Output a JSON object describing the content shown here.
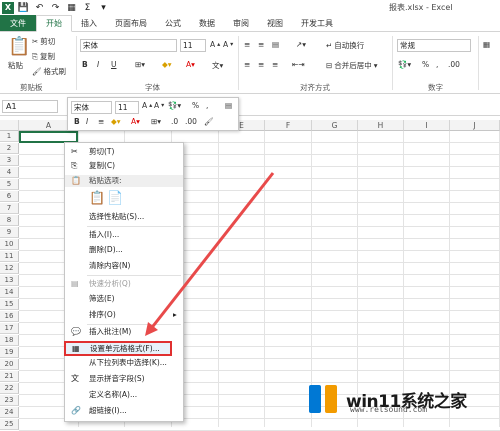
{
  "title_bar": {
    "doc_title": "报表.xlsx - Excel",
    "sum_glyph": "Σ"
  },
  "tabs": [
    {
      "label": "文件"
    },
    {
      "label": "开始"
    },
    {
      "label": "插入"
    },
    {
      "label": "页面布局"
    },
    {
      "label": "公式"
    },
    {
      "label": "数据"
    },
    {
      "label": "审阅"
    },
    {
      "label": "视图"
    },
    {
      "label": "开发工具"
    }
  ],
  "ribbon": {
    "clipboard": {
      "paste": "粘贴",
      "cut": "剪切",
      "copy": "复制",
      "format_painter": "格式刷",
      "label": "剪贴板"
    },
    "font": {
      "name": "宋体",
      "size": "11",
      "label": "字体",
      "bold": "B",
      "italic": "I",
      "underline": "U"
    },
    "alignment": {
      "wrap": "自动换行",
      "merge": "合并后居中",
      "label": "对齐方式"
    },
    "number": {
      "format": "常规",
      "label": "数字"
    }
  },
  "formula_bar": {
    "name_box": "A1",
    "fx": "fx"
  },
  "grid": {
    "columns": [
      "A",
      "B",
      "C",
      "D",
      "E",
      "F",
      "G",
      "H",
      "I",
      "J"
    ],
    "rows": [
      "1",
      "2",
      "3",
      "4",
      "5",
      "6",
      "7",
      "8",
      "9",
      "10",
      "11",
      "12",
      "13",
      "14",
      "15",
      "16",
      "17",
      "18",
      "19",
      "20",
      "21",
      "22",
      "23",
      "24",
      "25"
    ]
  },
  "mini_toolbar": {
    "font": "宋体",
    "size": "11",
    "bold": "B",
    "italic": "I",
    "percent": "%"
  },
  "context_menu": {
    "items": [
      {
        "label": "剪切(T)"
      },
      {
        "label": "复制(C)"
      },
      {
        "label": "粘贴选项:"
      },
      {
        "label": "选择性粘贴(S)..."
      },
      {
        "label": "插入(I)..."
      },
      {
        "label": "删除(D)..."
      },
      {
        "label": "清除内容(N)"
      },
      {
        "label": "快速分析(Q)"
      },
      {
        "label": "筛选(E)"
      },
      {
        "label": "排序(O)"
      },
      {
        "label": "插入批注(M)"
      },
      {
        "label": "设置单元格格式(F)..."
      },
      {
        "label": "从下拉列表中选择(K)..."
      },
      {
        "label": "显示拼音字段(S)"
      },
      {
        "label": "定义名称(A)..."
      },
      {
        "label": "超链接(I)..."
      }
    ]
  },
  "watermark": {
    "text": "win11系统之家",
    "url": "www.relsound.com"
  },
  "colors": {
    "excel_green": "#217346",
    "highlight_red": "#e03030",
    "arrow_red": "#e84a4a"
  }
}
